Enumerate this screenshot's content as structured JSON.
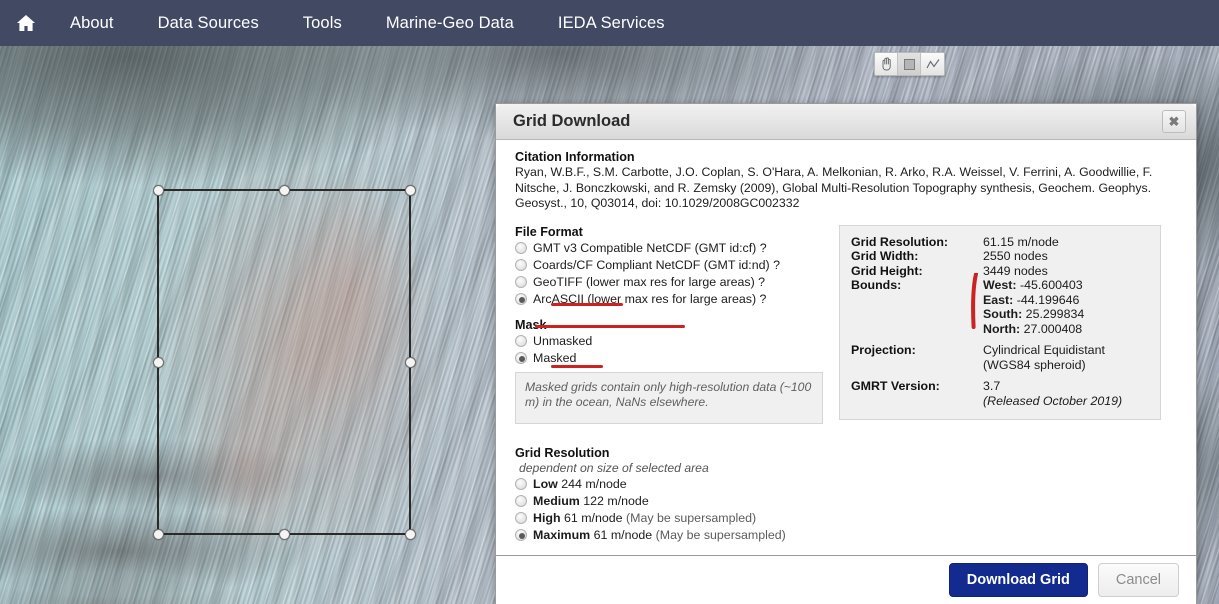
{
  "navbar": {
    "home_icon": "home-icon",
    "items": [
      {
        "label": "About"
      },
      {
        "label": "Data Sources"
      },
      {
        "label": "Tools"
      },
      {
        "label": "Marine-Geo Data"
      },
      {
        "label": "IEDA Services"
      }
    ]
  },
  "map_toolbar": {
    "buttons": [
      {
        "icon": "pan-hand-icon",
        "active": false
      },
      {
        "icon": "rectangle-select-icon",
        "active": true
      },
      {
        "icon": "profile-line-icon",
        "active": false
      }
    ]
  },
  "dialog": {
    "title": "Grid Download",
    "close_label": "✖",
    "citation": {
      "heading": "Citation Information",
      "text": "Ryan, W.B.F., S.M. Carbotte, J.O. Coplan, S. O'Hara, A. Melkonian, R. Arko, R.A. Weissel, V. Ferrini, A. Goodwillie, F. Nitsche, J. Bonczkowski, and R. Zemsky (2009), Global Multi-Resolution Topography synthesis, Geochem. Geophys. Geosyst., 10, Q03014, doi: 10.1029/2008GC002332"
    },
    "file_format": {
      "heading": "File Format",
      "options": [
        {
          "label": "GMT v3 Compatible NetCDF (GMT id:cf)",
          "help": "?",
          "selected": false
        },
        {
          "label": "Coards/CF Compliant NetCDF (GMT id:nd)",
          "help": "?",
          "selected": false
        },
        {
          "label": "GeoTIFF (lower max res for large areas)",
          "help": "?",
          "selected": false
        },
        {
          "label": "ArcASCII (lower max res for large areas)",
          "help": "?",
          "selected": true
        }
      ]
    },
    "mask": {
      "heading": "Mask",
      "options": [
        {
          "label": "Unmasked",
          "selected": false
        },
        {
          "label": "Masked",
          "selected": true
        }
      ],
      "note": "Masked grids contain only high-resolution data (~100 m) in the ocean, NaNs elsewhere."
    },
    "grid_resolution": {
      "heading": "Grid Resolution",
      "subnote": "dependent on size of selected area",
      "options": [
        {
          "name": "Low",
          "value": "244 m/node",
          "extra": "",
          "selected": false
        },
        {
          "name": "Medium",
          "value": "122 m/node",
          "extra": "",
          "selected": false
        },
        {
          "name": "High",
          "value": "61 m/node",
          "extra": "(May be supersampled)",
          "selected": false
        },
        {
          "name": "Maximum",
          "value": "61 m/node",
          "extra": "(May be supersampled)",
          "selected": true
        }
      ]
    },
    "info_panel": {
      "grid_resolution_key": "Grid Resolution:",
      "grid_resolution_val": "61.15 m/node",
      "grid_width_key": "Grid Width:",
      "grid_width_val": "2550 nodes",
      "grid_height_key": "Grid Height:",
      "grid_height_val": "3449 nodes",
      "bounds_key": "Bounds:",
      "bounds": {
        "west_key": "West:",
        "west_val": " -45.600403",
        "east_key": "East:",
        "east_val": " -44.199646",
        "south_key": "South:",
        "south_val": " 25.299834",
        "north_key": "North:",
        "north_val": " 27.000408"
      },
      "projection_key": "Projection:",
      "projection_val": "Cylindrical Equidistant",
      "projection_val2": "(WGS84 spheroid)",
      "gmrt_key": "GMRT Version:",
      "gmrt_val": "3.7",
      "gmrt_val2": "(Released October 2019)"
    },
    "footer": {
      "download_label": "Download Grid",
      "cancel_label": "Cancel"
    }
  },
  "annotations": {
    "color": "#cc2222",
    "marks": [
      {
        "target": "arcascii-option"
      },
      {
        "target": "masked-option"
      },
      {
        "target": "maximum-resolution-option"
      },
      {
        "target": "bounds-values"
      }
    ]
  },
  "colors": {
    "navbar_bg": "#414963",
    "primary_button": "#132a8e",
    "annotation_red": "#cc2222",
    "selection_outline": "#2a2a2a"
  }
}
